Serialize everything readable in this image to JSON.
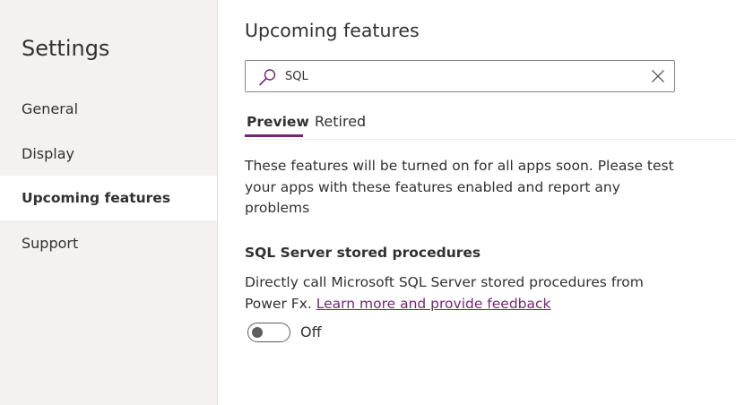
{
  "sidebar": {
    "title": "Settings",
    "items": [
      {
        "label": "General"
      },
      {
        "label": "Display"
      },
      {
        "label": "Upcoming features"
      },
      {
        "label": "Support"
      }
    ],
    "selected_item": "Upcoming features"
  },
  "main": {
    "title": "Upcoming features",
    "search": {
      "value": "SQL"
    },
    "tabs": [
      {
        "label": "Preview",
        "selected": true
      },
      {
        "label": "Retired",
        "selected": false
      }
    ],
    "description": "These features will be turned on for all apps soon. Please test your apps with these features enabled and report any problems",
    "feature": {
      "title": "SQL Server stored procedures",
      "description": "Directly call Microsoft SQL Server stored procedures from Power Fx.",
      "link_text": "Learn more and provide feedback",
      "toggle_label": "Off",
      "toggle_on": false
    }
  },
  "colors": {
    "accent": "#742774",
    "sidebar_bg": "#f3f2f1",
    "text": "#323130"
  },
  "icons": {
    "search": "search-icon",
    "clear": "close-icon"
  }
}
